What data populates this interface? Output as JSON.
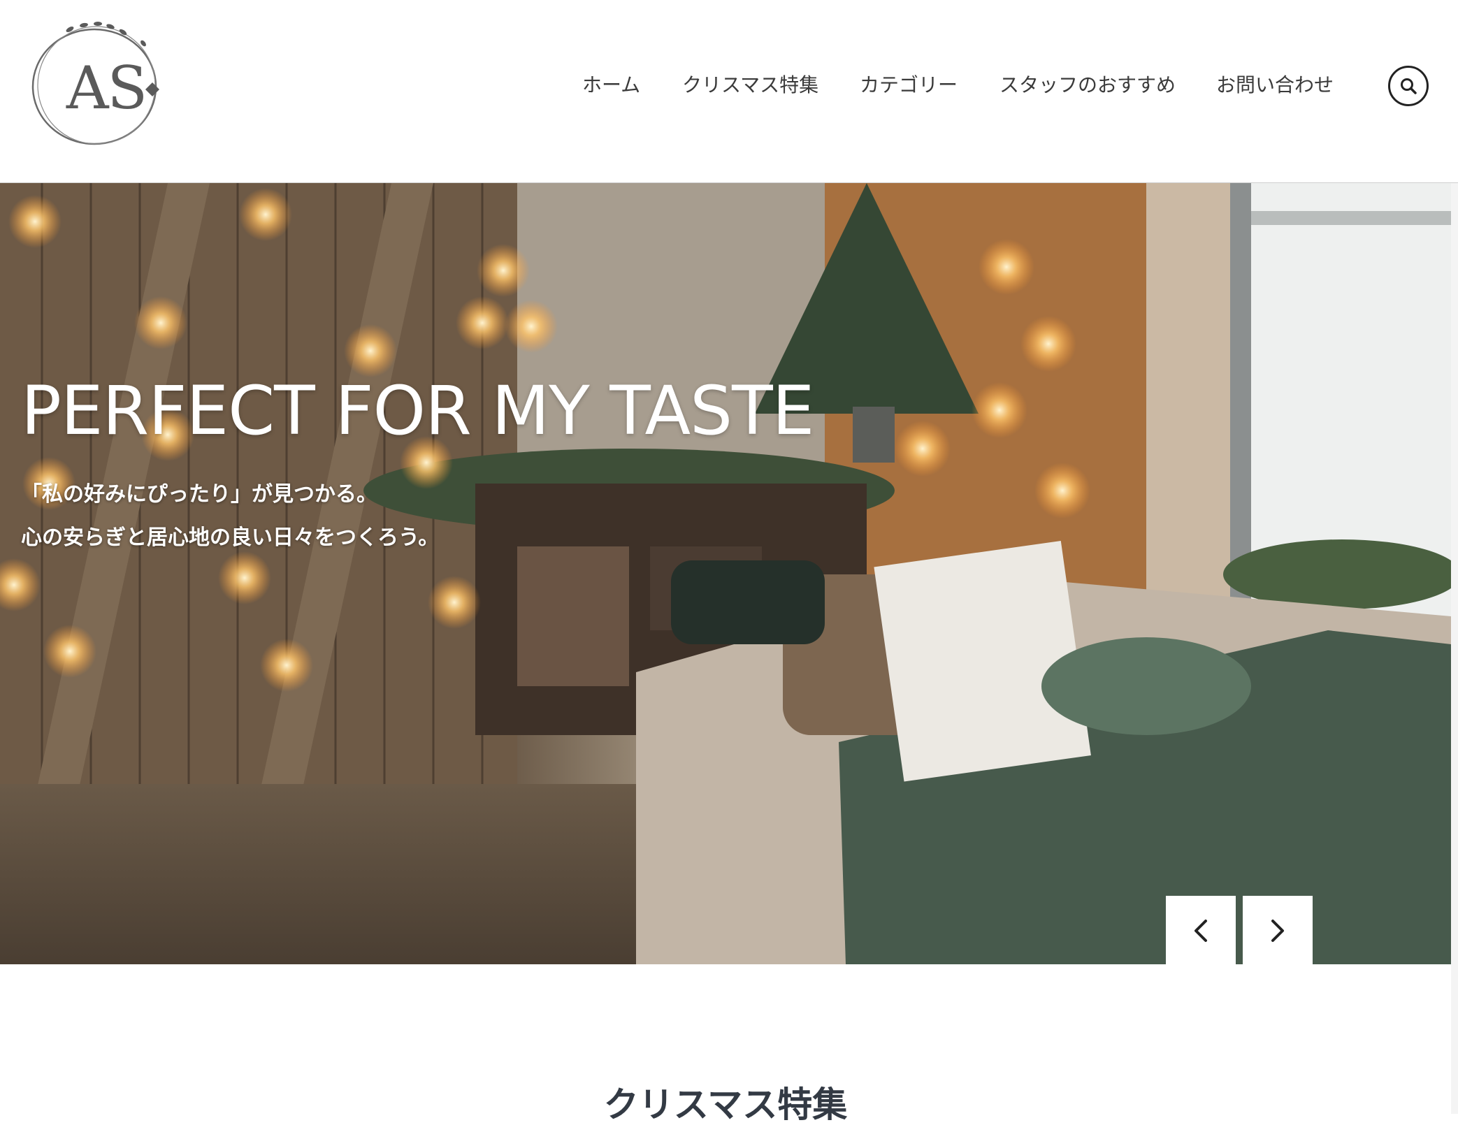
{
  "logo": {
    "text": "AS"
  },
  "nav": {
    "items": [
      {
        "label": "ホーム"
      },
      {
        "label": "クリスマス特集"
      },
      {
        "label": "カテゴリー"
      },
      {
        "label": "スタッフのおすすめ"
      },
      {
        "label": "お問い合わせ"
      }
    ]
  },
  "search": {
    "icon": "search-icon"
  },
  "hero": {
    "title": "PERFECT FOR MY TASTE",
    "subtitle_line1": "「私の好みにぴったり」が見つかる。",
    "subtitle_line2": "心の安らぎと居心地の良い日々をつくろう。",
    "prev_icon": "chevron-left-icon",
    "next_icon": "chevron-right-icon"
  },
  "section": {
    "title": "クリスマス特集"
  },
  "colors": {
    "text": "#3a3a3a",
    "header_bg": "#ffffff",
    "hero_text": "#ffffff"
  }
}
